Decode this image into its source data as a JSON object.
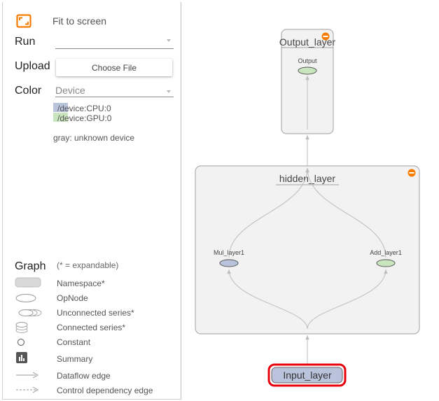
{
  "sidebar": {
    "fit_label": "Fit to screen",
    "run_label": "Run",
    "run_value": "",
    "upload_label": "Upload",
    "choose_file_label": "Choose File",
    "color_label": "Color",
    "color_value": "Device",
    "device_legend": [
      {
        "label": "/device:CPU:0",
        "color": "#b9c3dc"
      },
      {
        "label": "/device:GPU:0",
        "color": "#c9e5bd"
      }
    ],
    "gray_note": "gray: unknown device"
  },
  "graph_legend": {
    "title": "Graph",
    "subtitle": "(* = expandable)",
    "items": [
      {
        "name": "namespace",
        "label": "Namespace*"
      },
      {
        "name": "opnode",
        "label": "OpNode"
      },
      {
        "name": "unconnected-series",
        "label": "Unconnected series*"
      },
      {
        "name": "connected-series",
        "label": "Connected series*"
      },
      {
        "name": "constant",
        "label": "Constant"
      },
      {
        "name": "summary",
        "label": "Summary"
      },
      {
        "name": "dataflow-edge",
        "label": "Dataflow edge"
      },
      {
        "name": "control-dependency-edge",
        "label": "Control dependency edge"
      }
    ]
  },
  "graph": {
    "output_layer": {
      "title": "Output_layer",
      "node_label": "Output"
    },
    "hidden_layer": {
      "title": "hidden_layer",
      "left_node": "Mul_layer1",
      "right_node": "Add_layer1"
    },
    "input_layer": {
      "title": "Input_layer"
    }
  },
  "colors": {
    "accent_orange": "#f57c00",
    "cpu": "#b9c3dc",
    "gpu": "#c9e5bd",
    "namespace_fill": "#f2f2f2",
    "namespace_border": "#b0b0b0",
    "selected_border": "#e8000d",
    "input_fill": "#b9c3dc"
  }
}
